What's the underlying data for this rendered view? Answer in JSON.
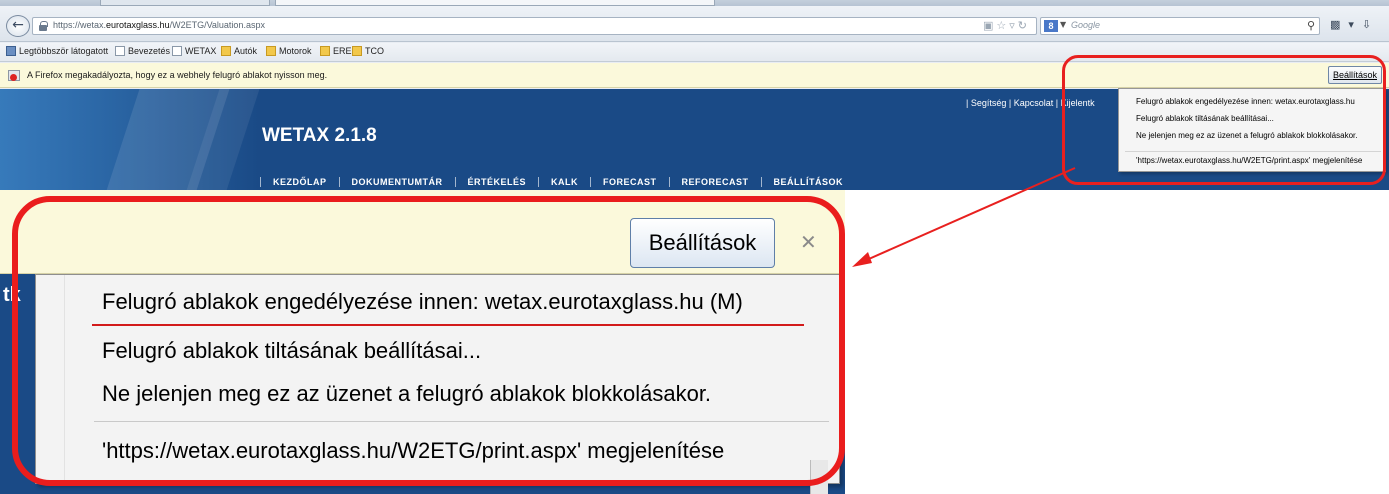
{
  "browser": {
    "url_prefix": "https://wetax.",
    "url_domain": "eurotaxglass.hu",
    "url_suffix": "/W2ETG/Valuation.aspx",
    "search_placeholder": "Google",
    "search_engine_label": "8",
    "bookmarks": [
      {
        "label": "Legtöbbször látogatott",
        "icon": "most-visited-icon"
      },
      {
        "label": "Bevezetés",
        "icon": "page-icon"
      },
      {
        "label": "WETAX",
        "icon": "page-icon"
      },
      {
        "label": "Autók",
        "icon": "folder-icon"
      },
      {
        "label": "Motorok",
        "icon": "folder-icon"
      },
      {
        "label": "ERE",
        "icon": "folder-icon"
      },
      {
        "label": "TCO",
        "icon": "folder-icon"
      }
    ]
  },
  "notification": {
    "text": "A Firefox megakadályozta, hogy ez a webhely felugró ablakot nyisson meg.",
    "button_label": "Beállítások"
  },
  "site": {
    "title": "WETAX 2.1.8",
    "top_links": "| Segítség  |  Kapcsolat  |  Kijelentk",
    "menu": [
      "KEZDŐLAP",
      "DOKUMENTUMTÁR",
      "ÉRTÉKELÉS",
      "KALK",
      "FORECAST",
      "REFORECAST",
      "BEÁLLÍTÁSOK"
    ],
    "zoom_edge_text": "tk"
  },
  "popup_menu": {
    "items": [
      "Felugró ablakok engedélyezése innen: wetax.eurotaxglass.hu",
      "Felugró ablakok tiltásának beállításai...",
      "Ne jelenjen meg ez az üzenet a felugró ablakok blokkolásakor.",
      "'https://wetax.eurotaxglass.hu/W2ETG/print.aspx' megjelenítése"
    ],
    "zoom_items": [
      "Felugró ablakok engedélyezése innen: wetax.eurotaxglass.hu (M)",
      "Felugró ablakok tiltásának beállításai...",
      "Ne jelenjen meg ez az üzenet a felugró ablakok blokkolásakor.",
      "'https://wetax.eurotaxglass.hu/W2ETG/print.aspx' megjelenítése"
    ]
  },
  "colors": {
    "annotation_red": "#e8201f",
    "site_blue": "#1a4a86",
    "notice_yellow": "#fbf9db"
  }
}
